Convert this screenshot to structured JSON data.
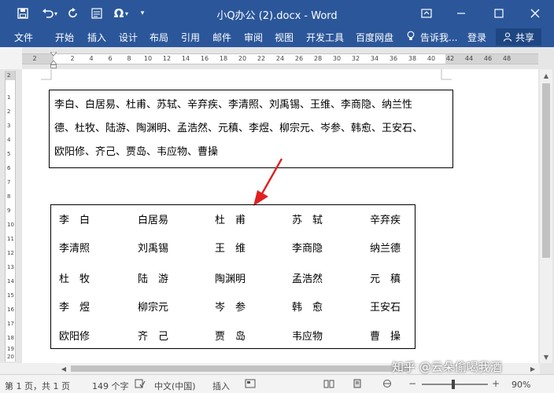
{
  "title_bar": {
    "document_title": "小Q办公 (2).docx - Word",
    "qat_icons": [
      "save-icon",
      "undo-icon",
      "redo-icon",
      "format-icon",
      "symbol-icon",
      "customize-icon"
    ],
    "symbol_glyph": "Ω",
    "window_icons": [
      "ribbon-display-icon",
      "minimize-icon",
      "maximize-icon",
      "close-icon"
    ]
  },
  "ribbon": {
    "tabs": [
      "文件",
      "开始",
      "插入",
      "设计",
      "布局",
      "引用",
      "邮件",
      "审阅",
      "视图",
      "开发工具",
      "百度网盘"
    ],
    "tell_me": "告诉我...",
    "sign_in": "登录",
    "share": "共享"
  },
  "ruler": {
    "ticks": [
      "2",
      "2",
      "4",
      "6",
      "8",
      "10",
      "12",
      "14",
      "16",
      "18",
      "20",
      "22",
      "24",
      "26",
      "28",
      "30",
      "32",
      "34",
      "36",
      "38",
      "40",
      "42",
      "44",
      "46",
      "48"
    ],
    "vticks": [
      "2",
      "1",
      "2",
      "3",
      "4",
      "5",
      "6",
      "7",
      "8",
      "9",
      "10",
      "11",
      "12",
      "13",
      "14",
      "15",
      "16",
      "17",
      "18",
      "19",
      "20"
    ]
  },
  "document": {
    "paragraph_lines": [
      "李白、白居易、杜甫、苏轼、辛弃疾、李清照、刘禹锡、王维、李商隐、纳兰性",
      "德、杜牧、陆游、陶渊明、孟浩然、元稹、李煜、柳宗元、岑参、韩愈、王安石、",
      "欧阳修、齐己、贾岛、韦应物、曹操"
    ],
    "table_rows": [
      [
        "李　白",
        "白居易",
        "杜　甫",
        "苏　轼",
        "辛弃疾"
      ],
      [
        "李清照",
        "刘禹锡",
        "王　维",
        "李商隐",
        "纳兰德"
      ],
      [
        "杜　牧",
        "陆　游",
        "陶渊明",
        "孟浩然",
        "元　稹"
      ],
      [
        "李　煜",
        "柳宗元",
        "岑　参",
        "韩　愈",
        "王安石"
      ],
      [
        "欧阳修",
        "齐　己",
        "贾　岛",
        "韦应物",
        "曹　操"
      ]
    ],
    "arrow_color": "#e02020"
  },
  "status_bar": {
    "page": "第 1 页，共 1 页",
    "words": "149 个字",
    "language": "中文(中国)",
    "mode": "插入",
    "zoom": "90%"
  },
  "watermark": "知乎 @云朵偷喝我酒",
  "colors": {
    "ribbon": "#2b579a",
    "share_button": "#1e4682"
  }
}
